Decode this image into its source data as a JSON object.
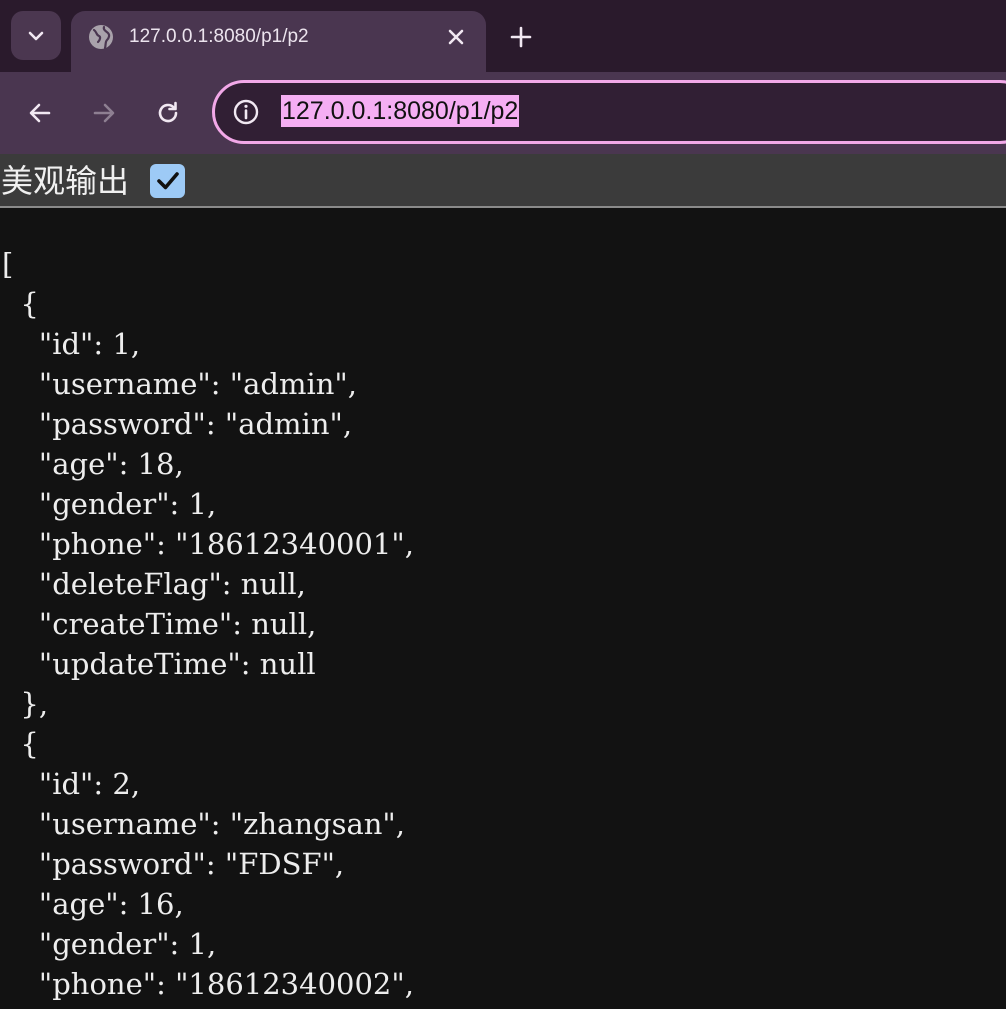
{
  "browser": {
    "tab": {
      "title": "127.0.0.1:8080/p1/p2",
      "favicon": "globe-icon"
    },
    "address_bar": {
      "url": "127.0.0.1:8080/p1/p2",
      "info_icon": "info-icon"
    },
    "nav": {
      "back_icon": "arrow-left-icon",
      "forward_icon": "arrow-right-icon",
      "reload_icon": "reload-icon",
      "new_tab_icon": "plus-icon",
      "tab_search_icon": "chevron-down-icon",
      "close_icon": "close-icon"
    },
    "colors": {
      "tabstrip_bg": "#2a1a2c",
      "toolbar_bg": "#4a3650",
      "omnibox_focus_ring": "#f2a8e8",
      "url_selection": "#f5aef3"
    }
  },
  "pretty_print": {
    "label": "美观输出",
    "checked": true
  },
  "json_lines": [
    "[",
    "  {",
    "    \"id\": 1,",
    "    \"username\": \"admin\",",
    "    \"password\": \"admin\",",
    "    \"age\": 18,",
    "    \"gender\": 1,",
    "    \"phone\": \"18612340001\",",
    "    \"deleteFlag\": null,",
    "    \"createTime\": null,",
    "    \"updateTime\": null",
    "  },",
    "  {",
    "    \"id\": 2,",
    "    \"username\": \"zhangsan\",",
    "    \"password\": \"FDSF\",",
    "    \"age\": 16,",
    "    \"gender\": 1,",
    "    \"phone\": \"18612340002\","
  ]
}
